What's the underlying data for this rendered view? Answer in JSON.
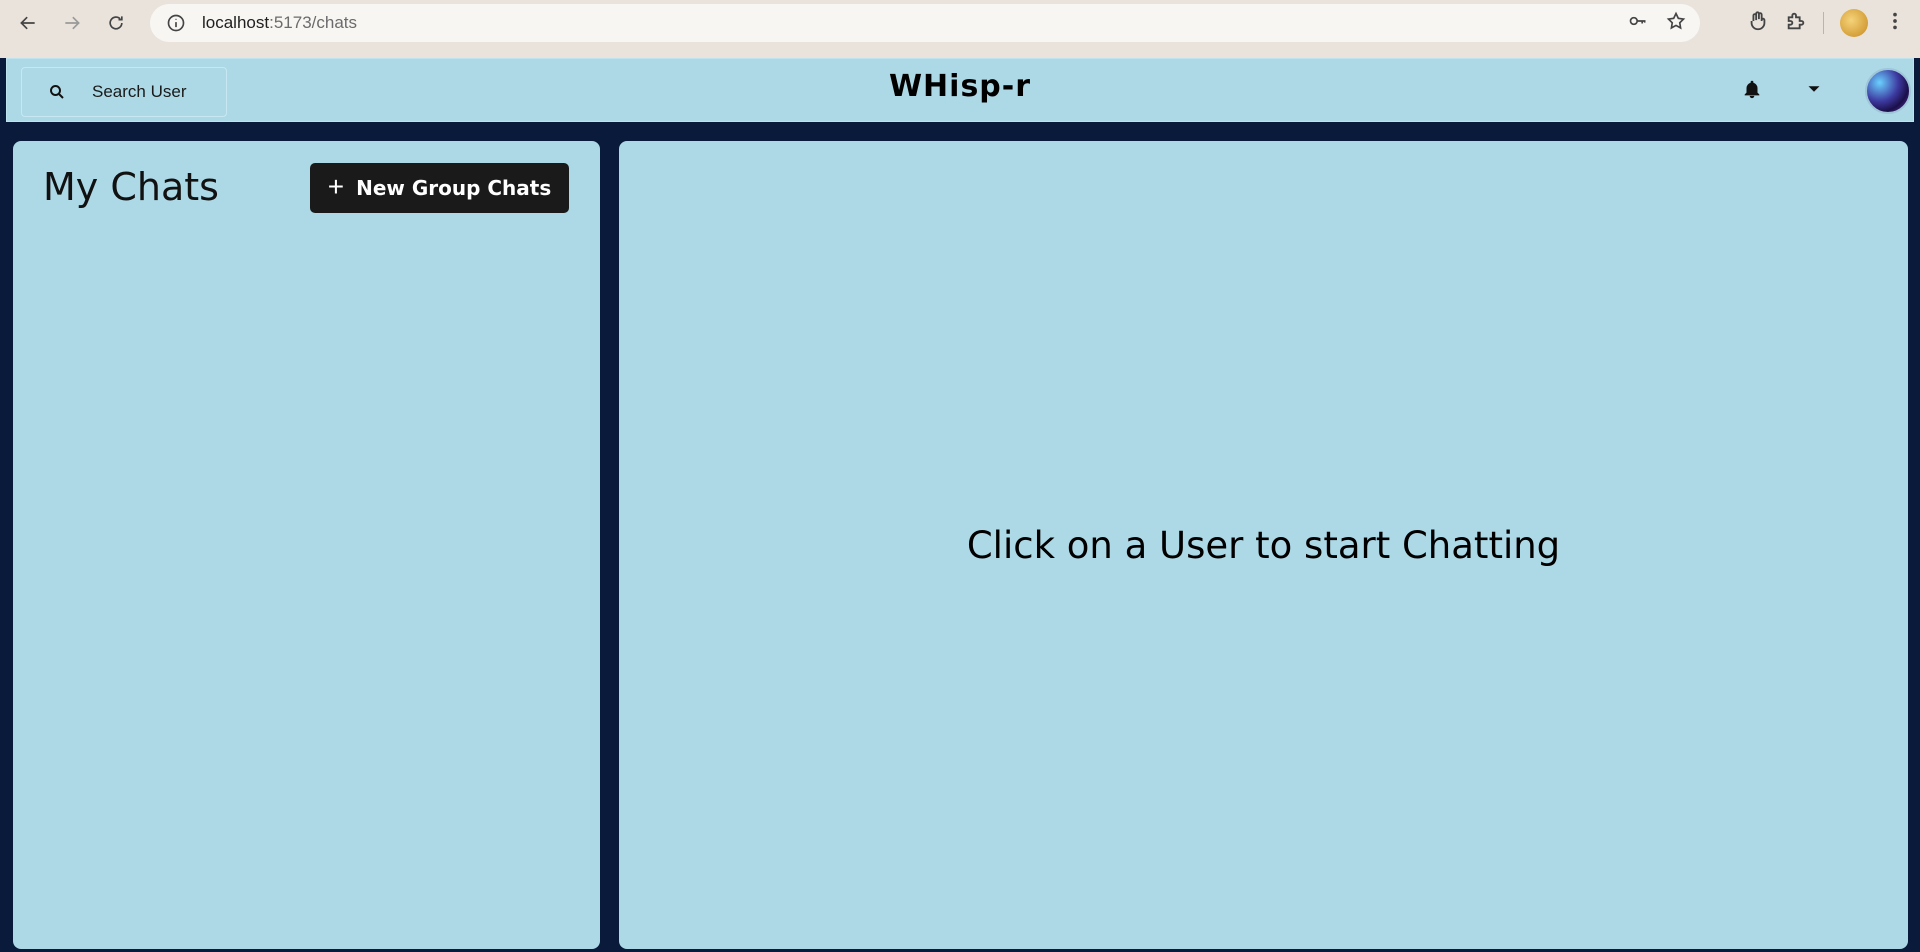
{
  "browser": {
    "url_host": "localhost",
    "url_path": ":5173/chats"
  },
  "header": {
    "search_label": "Search User",
    "app_title": "WHisp-r"
  },
  "sidebar": {
    "title": "My Chats",
    "new_group_label": "New Group Chats"
  },
  "chat": {
    "empty_message": "Click on a User to start Chatting"
  },
  "colors": {
    "panel_bg": "#add8e6",
    "page_bg": "#0a1a3a",
    "button_bg": "#1a1a1a"
  }
}
